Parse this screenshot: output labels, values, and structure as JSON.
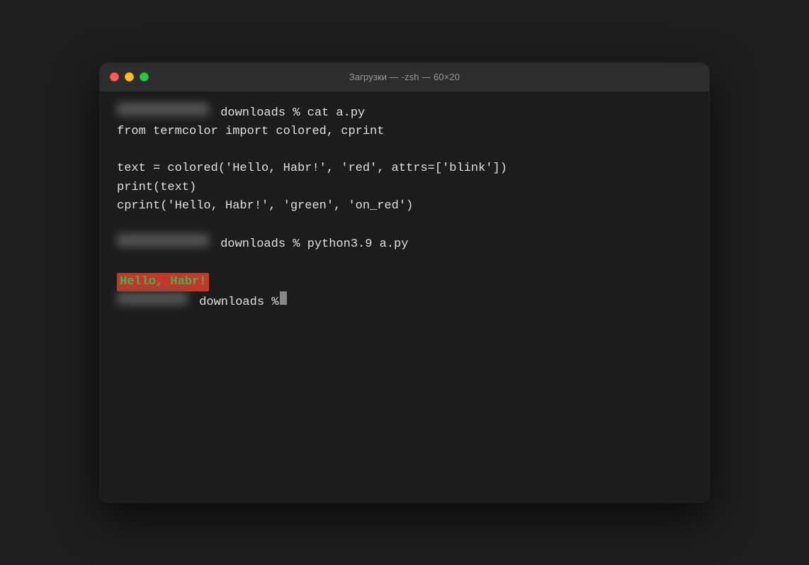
{
  "window": {
    "titlebar": {
      "title": "Загрузки — -zsh — 60×20"
    },
    "traffic_lights": {
      "close_label": "close",
      "minimize_label": "minimize",
      "maximize_label": "maximize"
    }
  },
  "terminal": {
    "line1_prompt": "downloads % cat a.py",
    "line2": "from termcolor import colored, cprint",
    "line3": "",
    "line4": "text = colored('Hello, Habr!', 'red', attrs=['blink'])",
    "line5": "print(text)",
    "line6": "cprint('Hello, Habr!', 'green', 'on_red')",
    "line7": "",
    "line8_prompt": "downloads % python3.9 a.py",
    "line9": "",
    "line10_output": "Hello, Habr!",
    "line11_prompt": "downloads % "
  }
}
